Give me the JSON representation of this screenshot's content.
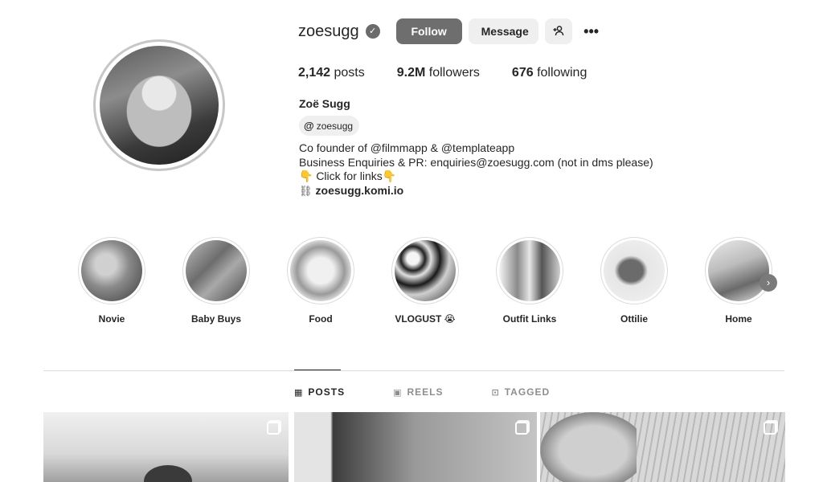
{
  "profile": {
    "username": "zoesugg",
    "verified_icon": "verified-badge-icon",
    "follow_label": "Follow",
    "message_label": "Message",
    "suggest_icon": "add-person-icon",
    "more_icon": "more-options-icon",
    "more_glyph": "•••",
    "stats": {
      "posts_count": "2,142",
      "posts_label": "posts",
      "followers_count": "9.2M",
      "followers_label": "followers",
      "following_count": "676",
      "following_label": "following"
    },
    "full_name": "Zoë Sugg",
    "threads_handle": "zoesugg",
    "bio_lines": [
      "Co founder of @filmmapp & @templateapp",
      "Business Enquiries & PR: enquiries@zoesugg.com (not in dms please)",
      "👇 Click for links👇"
    ],
    "link": "zoesugg.komi.io"
  },
  "highlights": [
    {
      "label": "Novie"
    },
    {
      "label": "Baby Buys"
    },
    {
      "label": "Food"
    },
    {
      "label": "VLOGUST 😭"
    },
    {
      "label": "Outfit Links"
    },
    {
      "label": "Ottilie"
    },
    {
      "label": "Home"
    }
  ],
  "tabs": [
    {
      "label": "POSTS",
      "icon": "grid-icon",
      "active": true
    },
    {
      "label": "REELS",
      "icon": "reels-icon",
      "active": false
    },
    {
      "label": "TAGGED",
      "icon": "tagged-icon",
      "active": false
    }
  ],
  "colors": {
    "follow_button": "#6e6e6e",
    "secondary_button": "#efefef",
    "text": "#262626",
    "muted": "#8e8e8e"
  }
}
